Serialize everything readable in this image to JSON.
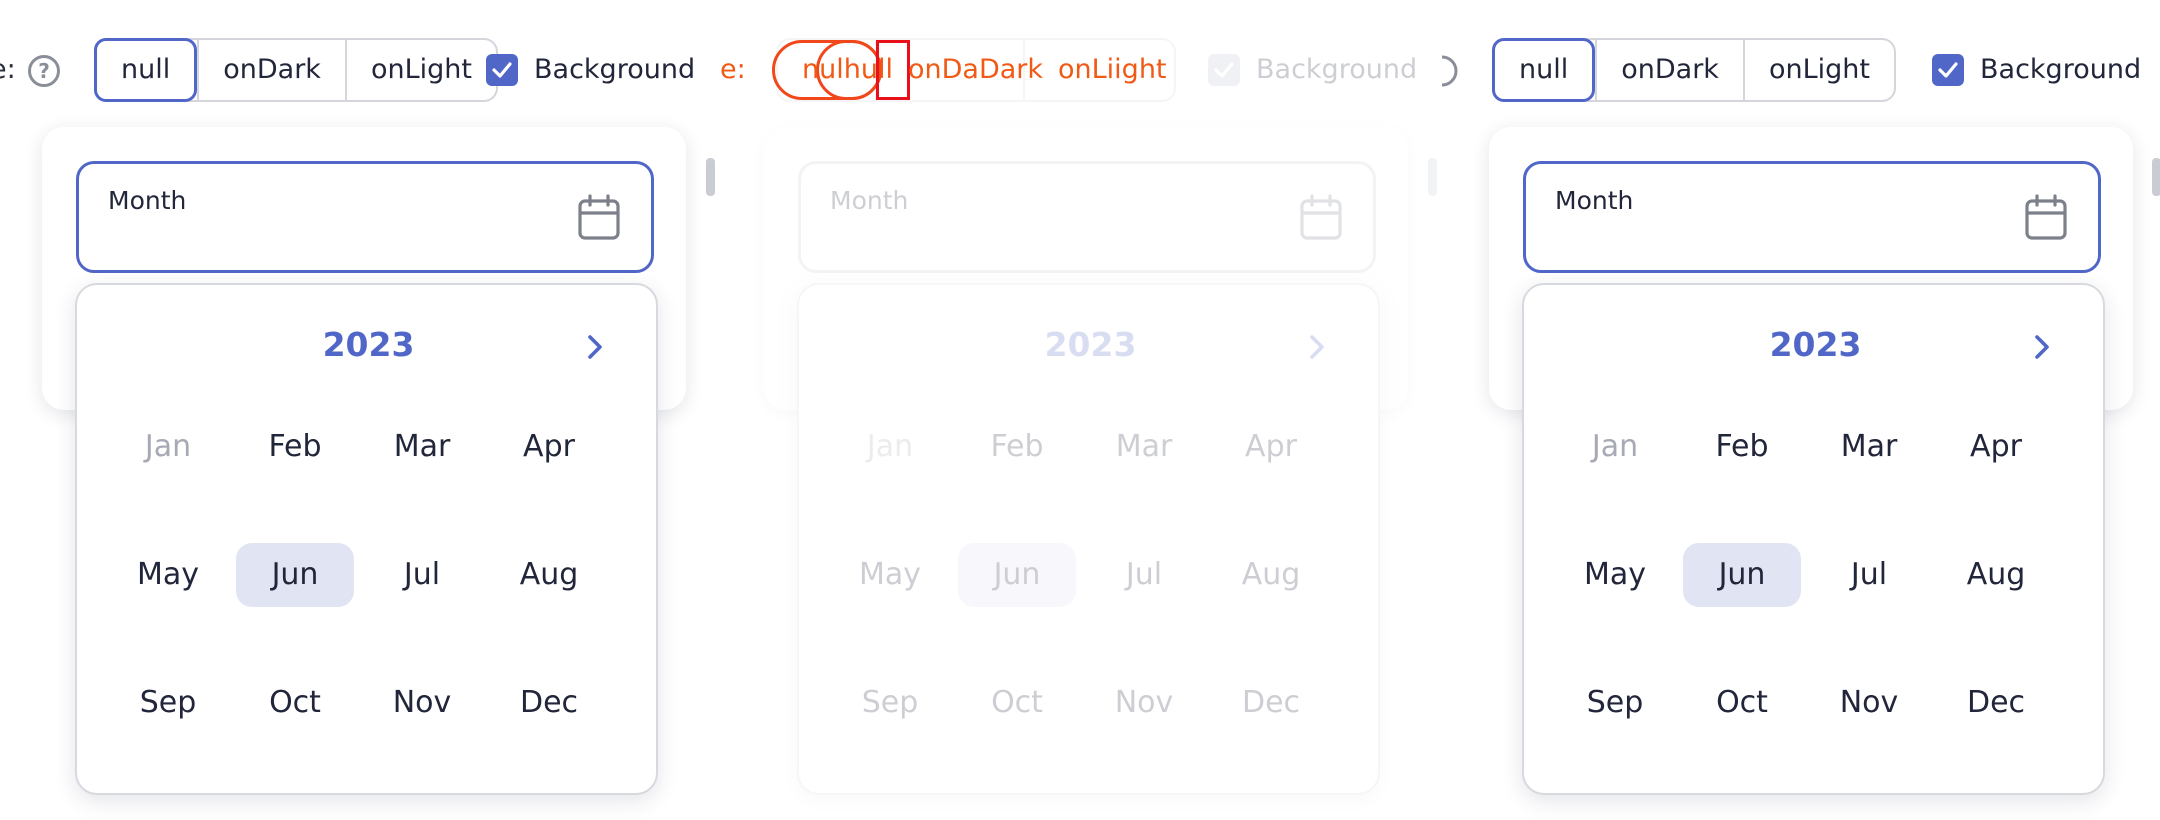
{
  "toolbar": {
    "theme_label": "Theme:",
    "theme_label_cut": "e:",
    "segments": [
      "null",
      "onDark",
      "onLight"
    ],
    "background_label": "Background"
  },
  "field": {
    "label": "Month"
  },
  "picker": {
    "year": "2023",
    "months": [
      "Jan",
      "Feb",
      "Mar",
      "Apr",
      "May",
      "Jun",
      "Jul",
      "Aug",
      "Sep",
      "Oct",
      "Nov",
      "Dec"
    ],
    "selected_month": "Jun",
    "disabled_months": [
      "Jan"
    ]
  },
  "glitch": {
    "overlay_text_a": "nulhull",
    "overlay_text_b": "onDaDark",
    "overlay_text_c": "onLiight"
  },
  "colors": {
    "accent": "#5067c8",
    "selected_bg": "#e1e4f3",
    "glitch_orange": "#f05a16",
    "glitch_red": "#e8101a"
  }
}
